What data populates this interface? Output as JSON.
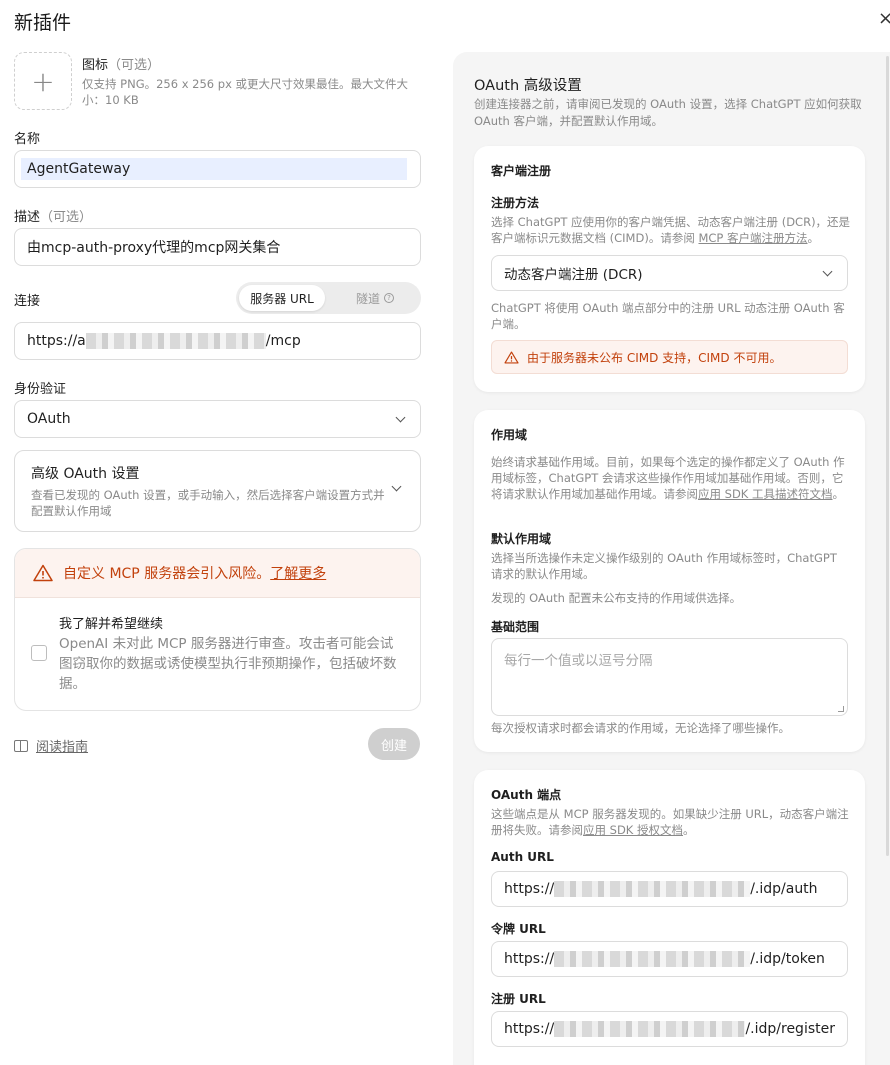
{
  "title": "新插件",
  "close_glyph": "×",
  "icon": {
    "plus": "+",
    "title": "图标",
    "optional": "（可选）",
    "hint": "仅支持 PNG。256 x 256 px 或更大尺寸效果最佳。最大文件大小：10 KB"
  },
  "name": {
    "label": "名称",
    "value": "AgentGateway"
  },
  "description": {
    "label": "描述",
    "optional": "（可选）",
    "value": "由mcp-auth-proxy代理的mcp网关集合"
  },
  "connection": {
    "label": "连接",
    "tab_server_url": "服务器 URL",
    "tab_tunnel": "隧道",
    "help_glyph": "?",
    "url_prefix": "https://a",
    "url_suffix": "/mcp"
  },
  "auth": {
    "label": "身份验证",
    "value": "OAuth"
  },
  "advanced": {
    "title": "高级 OAuth 设置",
    "desc": "查看已发现的 OAuth 设置，或手动输入，然后选择客户端设置方式并配置默认作用域"
  },
  "risk": {
    "warning": "自定义 MCP 服务器会引入风险。",
    "learn_more": "了解更多",
    "ack_title": "我了解并希望继续",
    "ack_desc": "OpenAI 未对此 MCP 服务器进行审查。攻击者可能会试图窃取你的数据或诱使模型执行非预期操作，包括破坏数据。"
  },
  "footer": {
    "guide": "阅读指南",
    "create": "创建"
  },
  "oauth_panel": {
    "title": "OAuth 高级设置",
    "desc": "创建连接器之前，请审阅已发现的 OAuth 设置，选择 ChatGPT 应如何获取 OAuth 客户端，并配置默认作用域。",
    "client_reg": {
      "heading": "客户端注册",
      "method_label": "注册方法",
      "method_desc": "选择 ChatGPT 应使用你的客户端凭据、动态客户端注册 (DCR)，还是客户端标识元数据文档 (CIMD)。请参阅 ",
      "method_link": "MCP 客户端注册方法",
      "method_end": "。",
      "selected": "动态客户端注册 (DCR)",
      "dcr_note": "ChatGPT 将使用 OAuth 端点部分中的注册 URL 动态注册 OAuth 客户端。",
      "cimd_warning": "由于服务器未公布 CIMD 支持，CIMD 不可用。"
    },
    "scopes": {
      "heading": "作用域",
      "desc": "始终请求基础作用域。目前，如果每个选定的操作都定义了 OAuth 作用域标签，ChatGPT 会请求这些操作作用域加基础作用域。否则，它将请求默认作用域加基础作用域。请参阅",
      "desc_link": "应用 SDK 工具描述符文档",
      "desc_end": "。",
      "default_label": "默认作用域",
      "default_desc": "选择当所选操作未定义操作级别的 OAuth 作用域标签时，ChatGPT 请求的默认作用域。",
      "default_note": "发现的 OAuth 配置未公布支持的作用域供选择。",
      "base_label": "基础范围",
      "base_placeholder": "每行一个值或以逗号分隔",
      "base_note": "每次授权请求时都会请求的作用域，无论选择了哪些操作。"
    },
    "endpoints": {
      "heading": "OAuth 端点",
      "desc": "这些端点是从 MCP 服务器发现的。如果缺少注册 URL，动态客户端注册将失败。请参阅",
      "desc_link": "应用 SDK 授权文档",
      "desc_end": "。",
      "auth_label": "Auth URL",
      "auth_prefix": "https://",
      "auth_suffix": "/.idp/auth",
      "token_label": "令牌 URL",
      "token_prefix": "https://",
      "token_suffix": "/.idp/token",
      "register_label": "注册 URL",
      "register_prefix": "https://",
      "register_suffix": "/.idp/register"
    }
  },
  "colors": {
    "warning": "#c2410c",
    "warning_bg": "#fdf3ef",
    "panel_bg": "#f5f5f5",
    "highlight": "#e8efff"
  }
}
